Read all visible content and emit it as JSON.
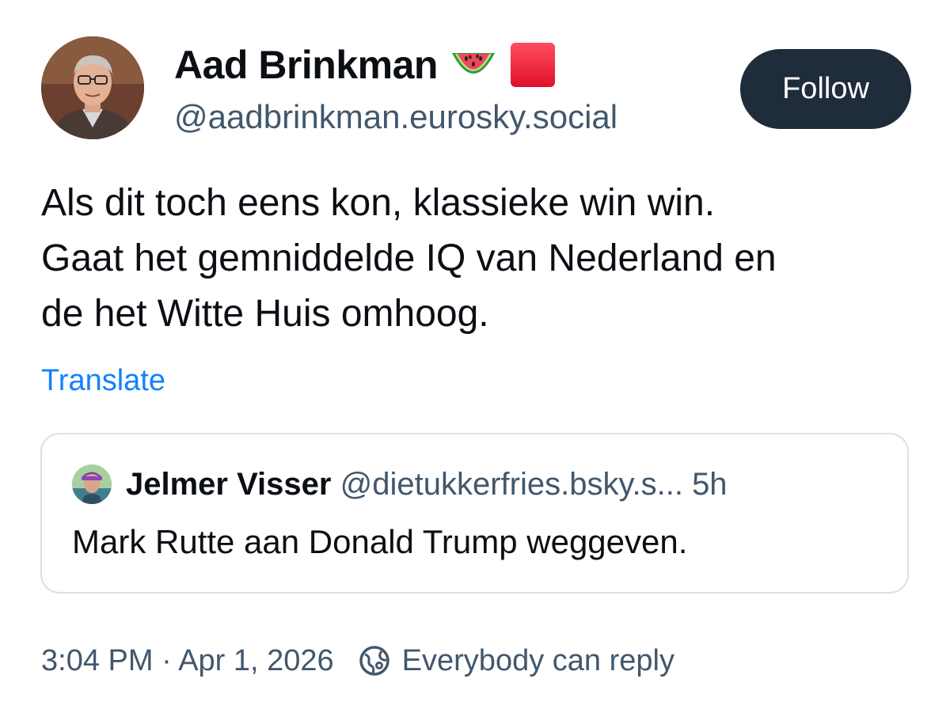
{
  "author": {
    "display_name": "Aad Brinkman",
    "emoji": [
      "watermelon-emoji",
      "red-square-emoji"
    ],
    "handle": "@aadbrinkman.eurosky.social"
  },
  "follow_label": "Follow",
  "post": {
    "lines": [
      "Als dit toch eens kon, klassieke win win.",
      "Gaat het gemniddelde IQ van Nederland en",
      "de het Witte Huis omhoog."
    ],
    "translate_label": "Translate"
  },
  "quote": {
    "name": "Jelmer Visser",
    "handle": "@dietukkerfries.bsky.s...",
    "time": "5h",
    "text": "Mark Rutte aan Donald Trump weggeven."
  },
  "footer": {
    "timestamp": "3:04 PM · Apr 1, 2026",
    "reply_setting": "Everybody can reply",
    "reply_icon": "globe-reply-icon"
  },
  "colors": {
    "follow_bg": "#1f2c3a",
    "link": "#1083fe",
    "secondary_text": "#42576c",
    "border": "#d8e0e8"
  }
}
